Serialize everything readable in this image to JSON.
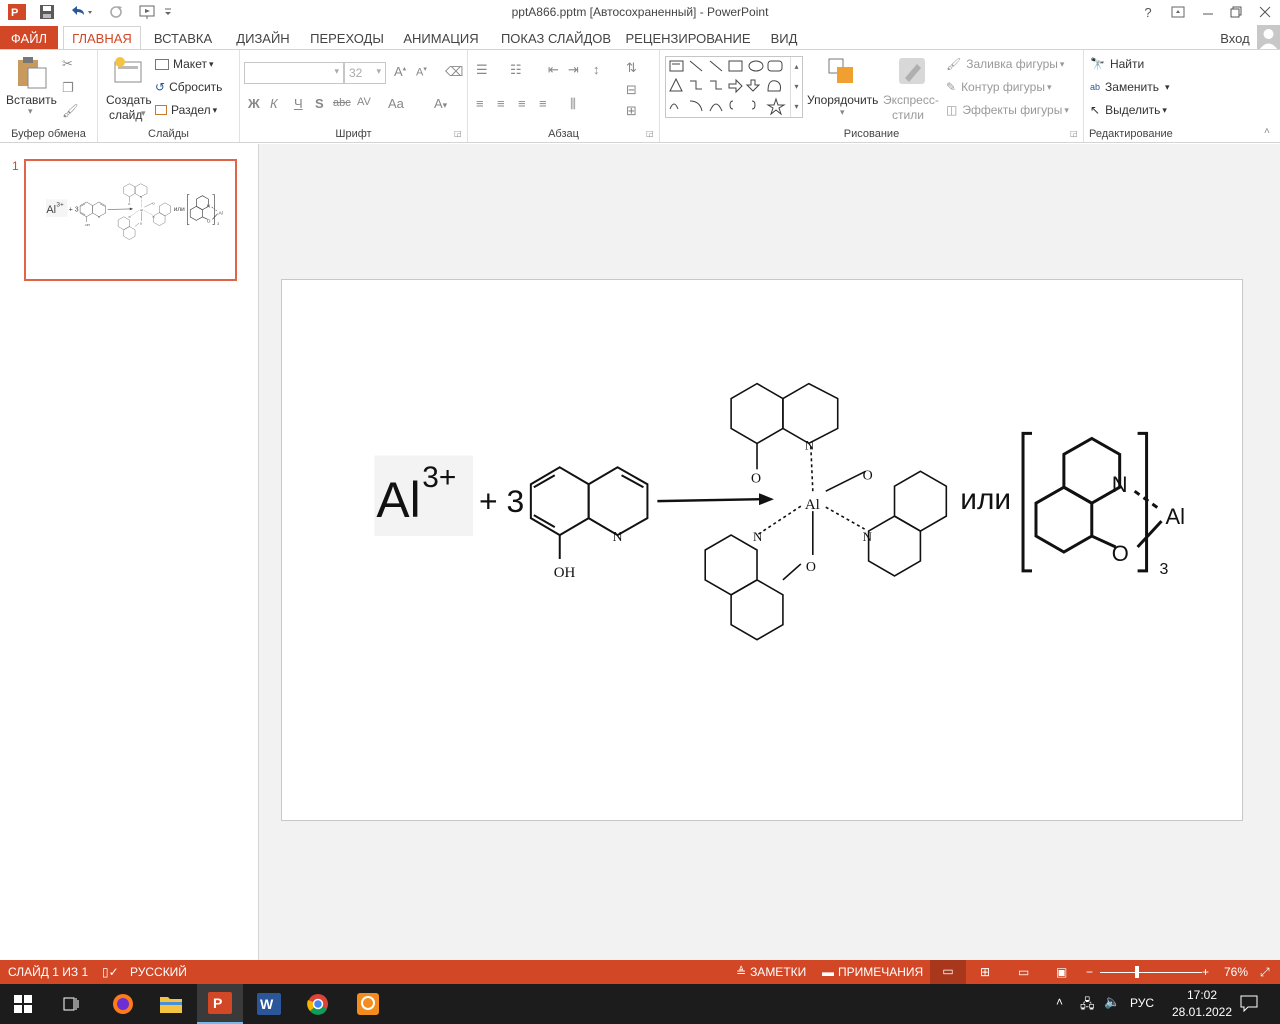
{
  "window": {
    "title": "pptA866.pptm [Автосохраненный] - PowerPoint",
    "help": "?",
    "login": "Вход"
  },
  "tabs": [
    {
      "label": "ФАЙЛ"
    },
    {
      "label": "ГЛАВНАЯ"
    },
    {
      "label": "ВСТАВКА"
    },
    {
      "label": "ДИЗАЙН"
    },
    {
      "label": "ПЕРЕХОДЫ"
    },
    {
      "label": "АНИМАЦИЯ"
    },
    {
      "label": "ПОКАЗ СЛАЙДОВ"
    },
    {
      "label": "РЕЦЕНЗИРОВАНИЕ"
    },
    {
      "label": "ВИД"
    }
  ],
  "ribbon": {
    "clipboard": {
      "label": "Буфер обмена",
      "paste": "Вставить"
    },
    "slides": {
      "label": "Слайды",
      "new_slide_1": "Создать",
      "new_slide_2": "слайд",
      "layout": "Макет",
      "reset": "Сбросить",
      "section": "Раздел"
    },
    "font": {
      "label": "Шрифт",
      "size": "32",
      "bold": "Ж",
      "italic": "К",
      "underline": "Ч",
      "shadow": "S",
      "strike": "abc",
      "spacing": "AV",
      "case": "Aa"
    },
    "paragraph": {
      "label": "Абзац"
    },
    "drawing": {
      "label": "Рисование",
      "arrange": "Упорядочить",
      "styles_1": "Экспресс-",
      "styles_2": "стили",
      "fill": "Заливка фигуры",
      "outline": "Контур фигуры",
      "effects": "Эффекты фигуры"
    },
    "editing": {
      "label": "Редактирование",
      "find": "Найти",
      "replace": "Заменить",
      "select": "Выделить"
    }
  },
  "thumbnail": {
    "number": "1"
  },
  "slide": {
    "ion": "Al",
    "charge": "3+",
    "plus": "+ 3",
    "or": "или",
    "subscript": "3",
    "atoms": {
      "N": "N",
      "O": "O",
      "OH": "OH",
      "Al": "Al"
    }
  },
  "status": {
    "slide": "СЛАЙД 1 ИЗ 1",
    "lang": "РУССКИЙ",
    "notes": "ЗАМЕТКИ",
    "comments": "ПРИМЕЧАНИЯ",
    "zoom": "76%",
    "zoom_level": 0.76
  },
  "taskbar": {
    "lang": "РУС",
    "time": "17:02",
    "date": "28.01.2022"
  },
  "colors": {
    "accent": "#d24726",
    "taskbar": "#1c1c1c"
  }
}
